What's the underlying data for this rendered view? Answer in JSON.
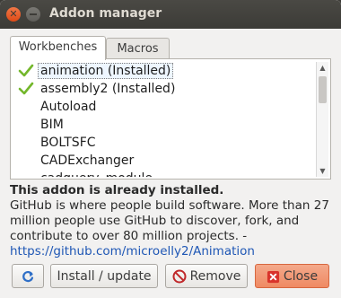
{
  "window": {
    "title": "Addon manager"
  },
  "tabs": [
    {
      "label": "Workbenches",
      "active": true
    },
    {
      "label": "Macros",
      "active": false
    }
  ],
  "addons": [
    {
      "name": "animation (Installed)",
      "installed": true,
      "selected": true
    },
    {
      "name": "assembly2 (Installed)",
      "installed": true,
      "selected": false
    },
    {
      "name": "Autoload",
      "installed": false
    },
    {
      "name": "BIM",
      "installed": false
    },
    {
      "name": "BOLTSFC",
      "installed": false
    },
    {
      "name": "CADExchanger",
      "installed": false
    },
    {
      "name": "cadquery_module",
      "installed": false
    }
  ],
  "info": {
    "status": "This addon is already installed.",
    "description": "GitHub is where people build software. More than 27 million people use GitHub to discover, fork, and contribute to over 80 million projects. -",
    "url": "https://github.com/microelly2/Animation"
  },
  "buttons": {
    "install": "Install / update",
    "remove": "Remove",
    "close": "Close"
  },
  "icons": {
    "installed": "check-icon",
    "refresh": "refresh-icon",
    "remove": "no-entry-icon",
    "close": "close-x-icon"
  },
  "colors": {
    "check": "#73b72b",
    "close_button": "#ef8a63",
    "link": "#1f57b5"
  }
}
